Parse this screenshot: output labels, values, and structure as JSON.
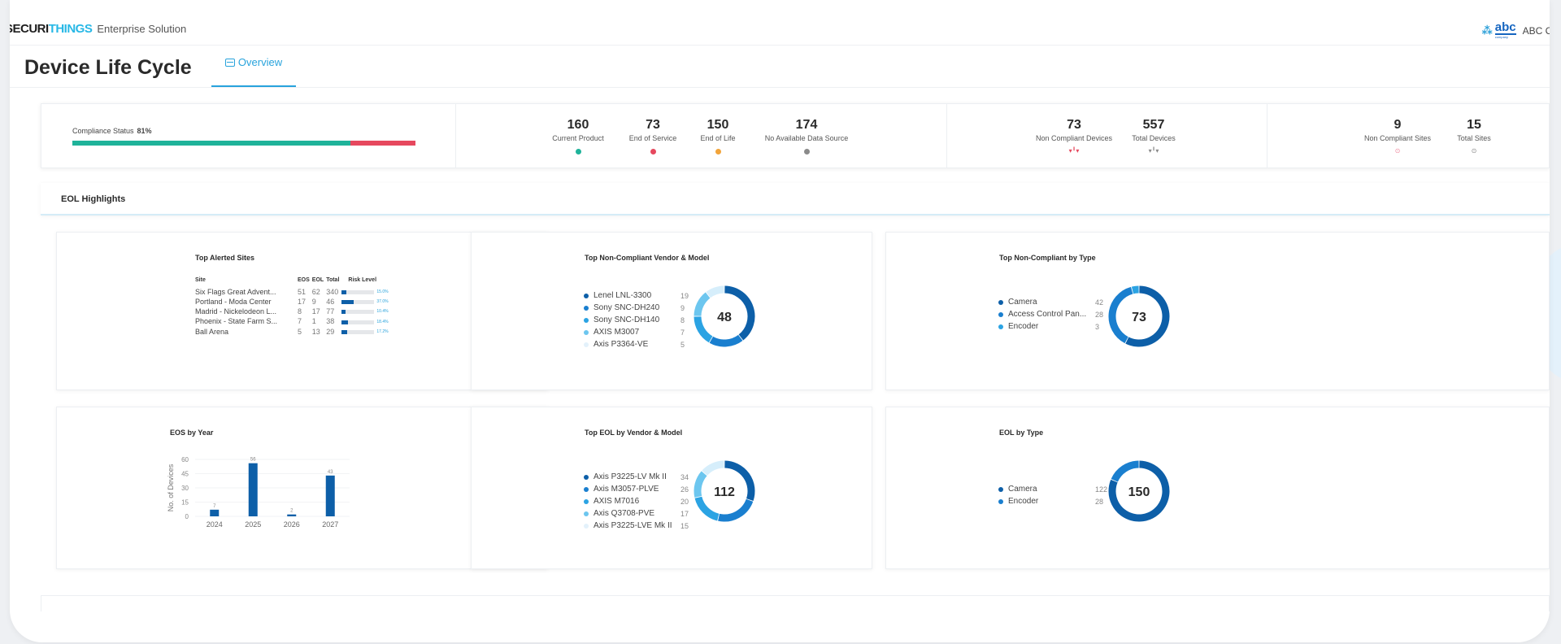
{
  "header": {
    "brand_prefix": "SECURI",
    "brand_accent": "THINGS",
    "brand_sub": "Enterprise Solution",
    "company_logo": "abc",
    "company_logo_small": "company",
    "company_name": "ABC Co"
  },
  "page": {
    "title": "Device Life Cycle",
    "tab_overview": "Overview"
  },
  "compliance": {
    "label": "Compliance Status",
    "percent_label": "81%",
    "percent": 81,
    "ok_color": "#1fb39a",
    "bad_color": "#e6485e"
  },
  "product_stats": [
    {
      "value": "160",
      "label": "Current Product",
      "color": "#1fb39a"
    },
    {
      "value": "73",
      "label": "End of Service",
      "color": "#e6485e"
    },
    {
      "value": "150",
      "label": "End of Life",
      "color": "#f2a43a"
    },
    {
      "value": "174",
      "label": "No Available Data Source",
      "color": "#8a8a8a"
    }
  ],
  "device_stats": [
    {
      "value": "73",
      "label": "Non Compliant Devices",
      "icon": "camera-icon"
    },
    {
      "value": "557",
      "label": "Total Devices",
      "icon": "camera-icon"
    }
  ],
  "site_stats": [
    {
      "value": "9",
      "label": "Non Compliant Sites",
      "icon": "location-pin-icon"
    },
    {
      "value": "15",
      "label": "Total Sites",
      "icon": "location-pin-icon"
    }
  ],
  "eol_highlights": {
    "title": "EOL Highlights"
  },
  "top_alerted_sites": {
    "title": "Top Alerted Sites",
    "columns": [
      "Site",
      "EOS",
      "EOL",
      "Total",
      "Risk Level"
    ],
    "rows": [
      {
        "site": "Six Flags Great Advent...",
        "eos": "51",
        "eol": "62",
        "total": "340",
        "risk": 15.0,
        "risk_label": "15.0%"
      },
      {
        "site": "Portland - Moda Center",
        "eos": "17",
        "eol": "9",
        "total": "46",
        "risk": 37.0,
        "risk_label": "37.0%"
      },
      {
        "site": "Madrid - Nickelodeon L...",
        "eos": "8",
        "eol": "17",
        "total": "77",
        "risk": 10.4,
        "risk_label": "10.4%"
      },
      {
        "site": "Phoenix - State Farm S...",
        "eos": "7",
        "eol": "1",
        "total": "38",
        "risk": 18.4,
        "risk_label": "18.4%"
      },
      {
        "site": "Ball Arena",
        "eos": "5",
        "eol": "13",
        "total": "29",
        "risk": 17.2,
        "risk_label": "17.2%"
      }
    ]
  },
  "chart_data": [
    {
      "type": "pie",
      "title": "Top Non-Compliant Vendor & Model",
      "center_label": "48",
      "categories": [
        "Lenel LNL-3300",
        "Sony SNC-DH240",
        "Sony SNC-DH140",
        "AXIS M3007",
        "Axis P3364-VE"
      ],
      "values": [
        19,
        9,
        8,
        7,
        5
      ],
      "colors": [
        "#0d5fa8",
        "#1a7fcf",
        "#2ba3e3",
        "#6cc6ef",
        "#d6eefb"
      ]
    },
    {
      "type": "pie",
      "title": "Top Non-Compliant by Type",
      "center_label": "73",
      "categories": [
        "Camera",
        "Access Control Pan...",
        "Encoder"
      ],
      "values": [
        42,
        28,
        3
      ],
      "colors": [
        "#0d5fa8",
        "#1a7fcf",
        "#2ba3e3"
      ]
    },
    {
      "type": "bar",
      "title": "EOS by Year",
      "categories": [
        "2024",
        "2025",
        "2026",
        "2027"
      ],
      "values": [
        7,
        56,
        2,
        43
      ],
      "ylabel": "No. of Devices",
      "ylim": [
        0,
        60
      ],
      "yticks": [
        0,
        15,
        30,
        45,
        60
      ],
      "color": "#0d5fa8"
    },
    {
      "type": "pie",
      "title": "Top EOL by Vendor & Model",
      "center_label": "112",
      "categories": [
        "Axis P3225-LV Mk II",
        "Axis M3057-PLVE",
        "AXIS M7016",
        "Axis Q3708-PVE",
        "Axis P3225-LVE Mk II"
      ],
      "values": [
        34,
        26,
        20,
        17,
        15
      ],
      "colors": [
        "#0d5fa8",
        "#1a7fcf",
        "#2ba3e3",
        "#6cc6ef",
        "#d6eefb"
      ]
    },
    {
      "type": "pie",
      "title": "EOL by Type",
      "center_label": "150",
      "categories": [
        "Camera",
        "Encoder"
      ],
      "values": [
        122,
        28
      ],
      "colors": [
        "#0d5fa8",
        "#1a7fcf"
      ]
    }
  ]
}
